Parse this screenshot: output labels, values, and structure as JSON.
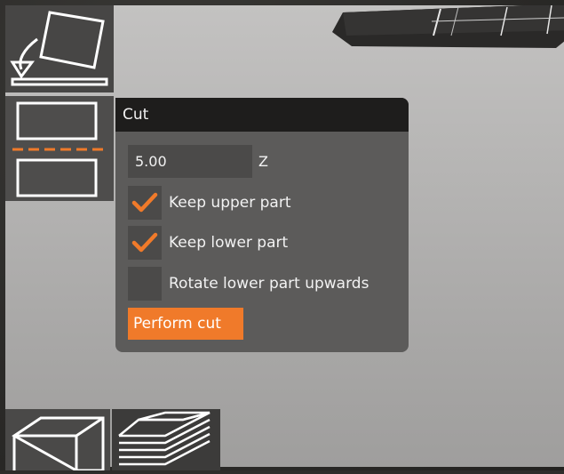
{
  "panel": {
    "title": "Cut",
    "cut_height": "5.00",
    "axis": "Z",
    "options": [
      {
        "label": "Keep upper part",
        "checked": true
      },
      {
        "label": "Keep lower part",
        "checked": true
      },
      {
        "label": "Rotate lower part upwards",
        "checked": false
      }
    ],
    "perform_label": "Perform cut"
  },
  "colors": {
    "accent": "#f07a2a",
    "panel": "#5c5b5a",
    "header": "#1e1d1c"
  },
  "icons": {
    "toolbar": [
      "lay-flat-icon",
      "cut-icon"
    ],
    "bottom": [
      "cube-icon",
      "layers-icon"
    ]
  }
}
